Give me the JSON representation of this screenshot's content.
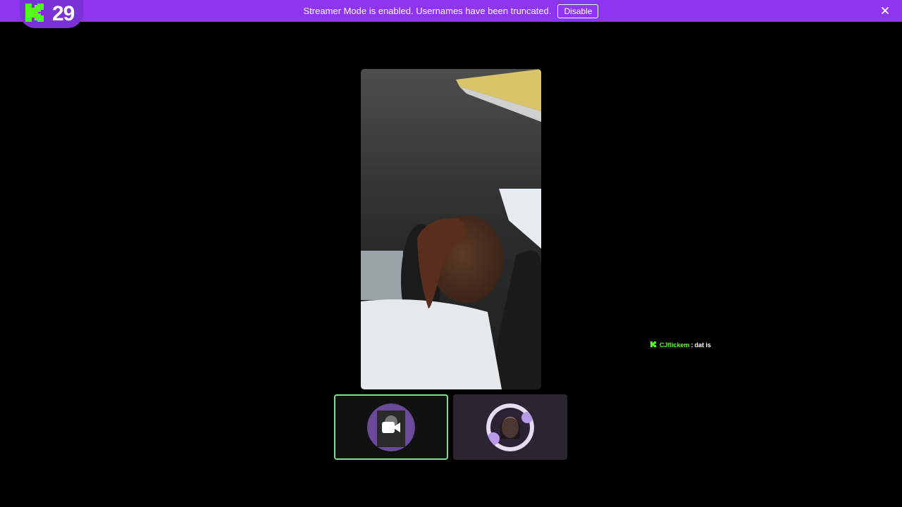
{
  "banner": {
    "text": "Streamer Mode is enabled. Usernames have been truncated.",
    "disable_label": "Disable",
    "background": "#8f35f0",
    "close_icon": "close-icon"
  },
  "header": {
    "logo_icon": "kick-logo-icon",
    "viewer_count": "29"
  },
  "stream": {
    "main_video": "webcam-video",
    "tiles": [
      {
        "name": "guest-tile-1",
        "icon": "video-camera-icon",
        "active": true
      },
      {
        "name": "guest-tile-2",
        "icon": "avatar",
        "active": false
      }
    ]
  },
  "chat": {
    "messages": [
      {
        "badge_icon": "kick-badge-icon",
        "username": "CJflickem",
        "separator": ":",
        "text": "dat is"
      }
    ]
  },
  "colors": {
    "accent_green": "#53fc18",
    "active_border": "#7ee18f"
  }
}
